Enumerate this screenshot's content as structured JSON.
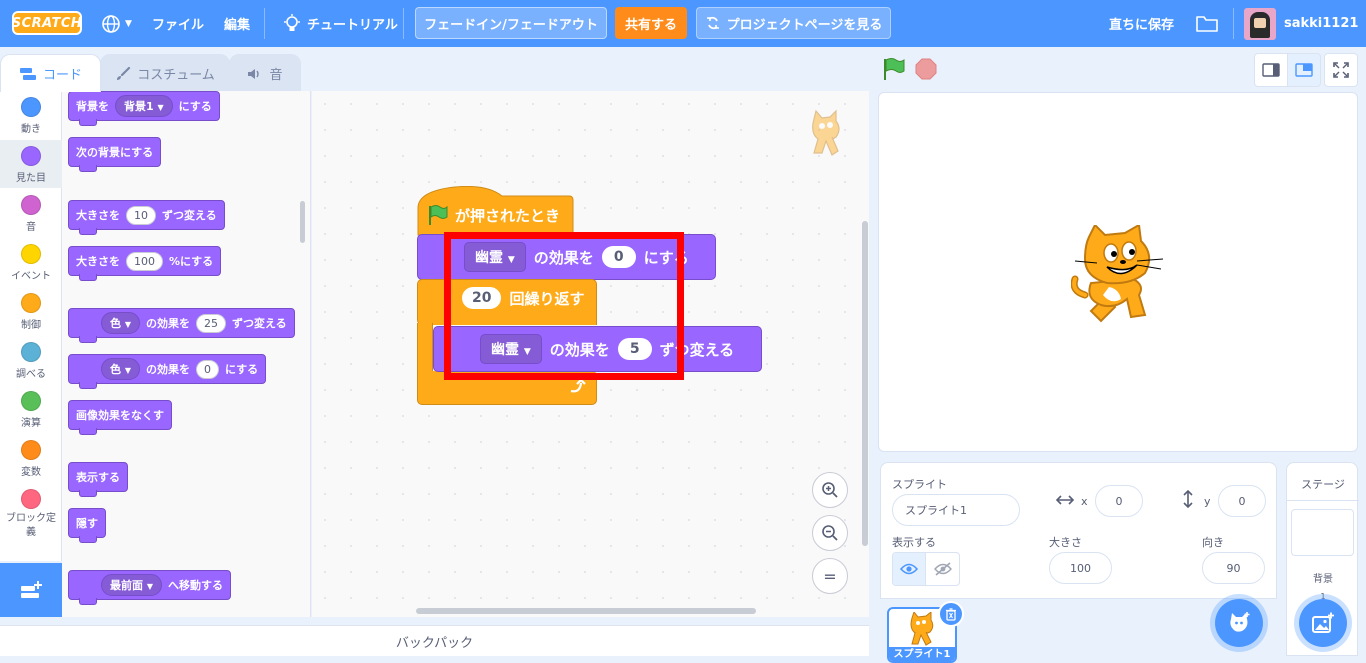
{
  "menubar": {
    "logo": "SCRATCH",
    "file": "ファイル",
    "edit": "編集",
    "tutorials": "チュートリアル",
    "project_title": "フェードイン/フェードアウト",
    "share": "共有する",
    "see_project_page": "プロジェクトページを見る",
    "save_now": "直ちに保存",
    "username": "sakki1121"
  },
  "tabs": {
    "code": "コード",
    "costumes": "コスチューム",
    "sounds": "音"
  },
  "categories": [
    {
      "label": "動き",
      "color": "#4c97ff"
    },
    {
      "label": "見た目",
      "color": "#9966ff"
    },
    {
      "label": "音",
      "color": "#cf63cf"
    },
    {
      "label": "イベント",
      "color": "#ffd500"
    },
    {
      "label": "制御",
      "color": "#ffab19"
    },
    {
      "label": "調べる",
      "color": "#5cb1d6"
    },
    {
      "label": "演算",
      "color": "#59c059"
    },
    {
      "label": "変数",
      "color": "#ff8c1a"
    },
    {
      "label": "ブロック定義",
      "color": "#ff6680"
    }
  ],
  "palette": {
    "switch_backdrop_pre": "背景を",
    "switch_backdrop_val": "背景1",
    "switch_backdrop_post": "にする",
    "next_backdrop": "次の背景にする",
    "change_size_pre": "大きさを",
    "change_size_val": "10",
    "change_size_post": "ずつ変える",
    "set_size_pre": "大きさを",
    "set_size_val": "100",
    "set_size_post": "%にする",
    "change_effect_drop": "色",
    "change_effect_mid": "の効果を",
    "change_effect_val": "25",
    "change_effect_post": "ずつ変える",
    "set_effect_drop": "色",
    "set_effect_mid": "の効果を",
    "set_effect_val": "0",
    "set_effect_post": "にする",
    "clear_effects": "画像効果をなくす",
    "show": "表示する",
    "hide": "隠す",
    "go_layer_drop": "最前面",
    "go_layer_post": "へ移動する"
  },
  "script": {
    "hat": "が押されたとき",
    "set_drop": "幽霊",
    "set_mid": "の効果を",
    "set_val": "0",
    "set_post": "にする",
    "repeat_val": "20",
    "repeat_label": "回繰り返す",
    "change_drop": "幽霊",
    "change_mid": "の効果を",
    "change_val": "5",
    "change_post": "ずつ変える"
  },
  "backpack": "バックパック",
  "sprite_info": {
    "sprite_label": "スプライト",
    "sprite_name": "スプライト1",
    "x_label": "x",
    "x_value": "0",
    "y_label": "y",
    "y_value": "0",
    "show_label": "表示する",
    "size_label": "大きさ",
    "size_value": "100",
    "direction_label": "向き",
    "direction_value": "90",
    "thumb_label": "スプライト1"
  },
  "stage_pane": {
    "title": "ステージ",
    "backdrops_label": "背景",
    "backdrops_count": "1"
  },
  "colors": {
    "menubar": "#4c97ff",
    "looks": "#9966ff",
    "control": "#ffab19",
    "highlight": "#ff0000"
  }
}
